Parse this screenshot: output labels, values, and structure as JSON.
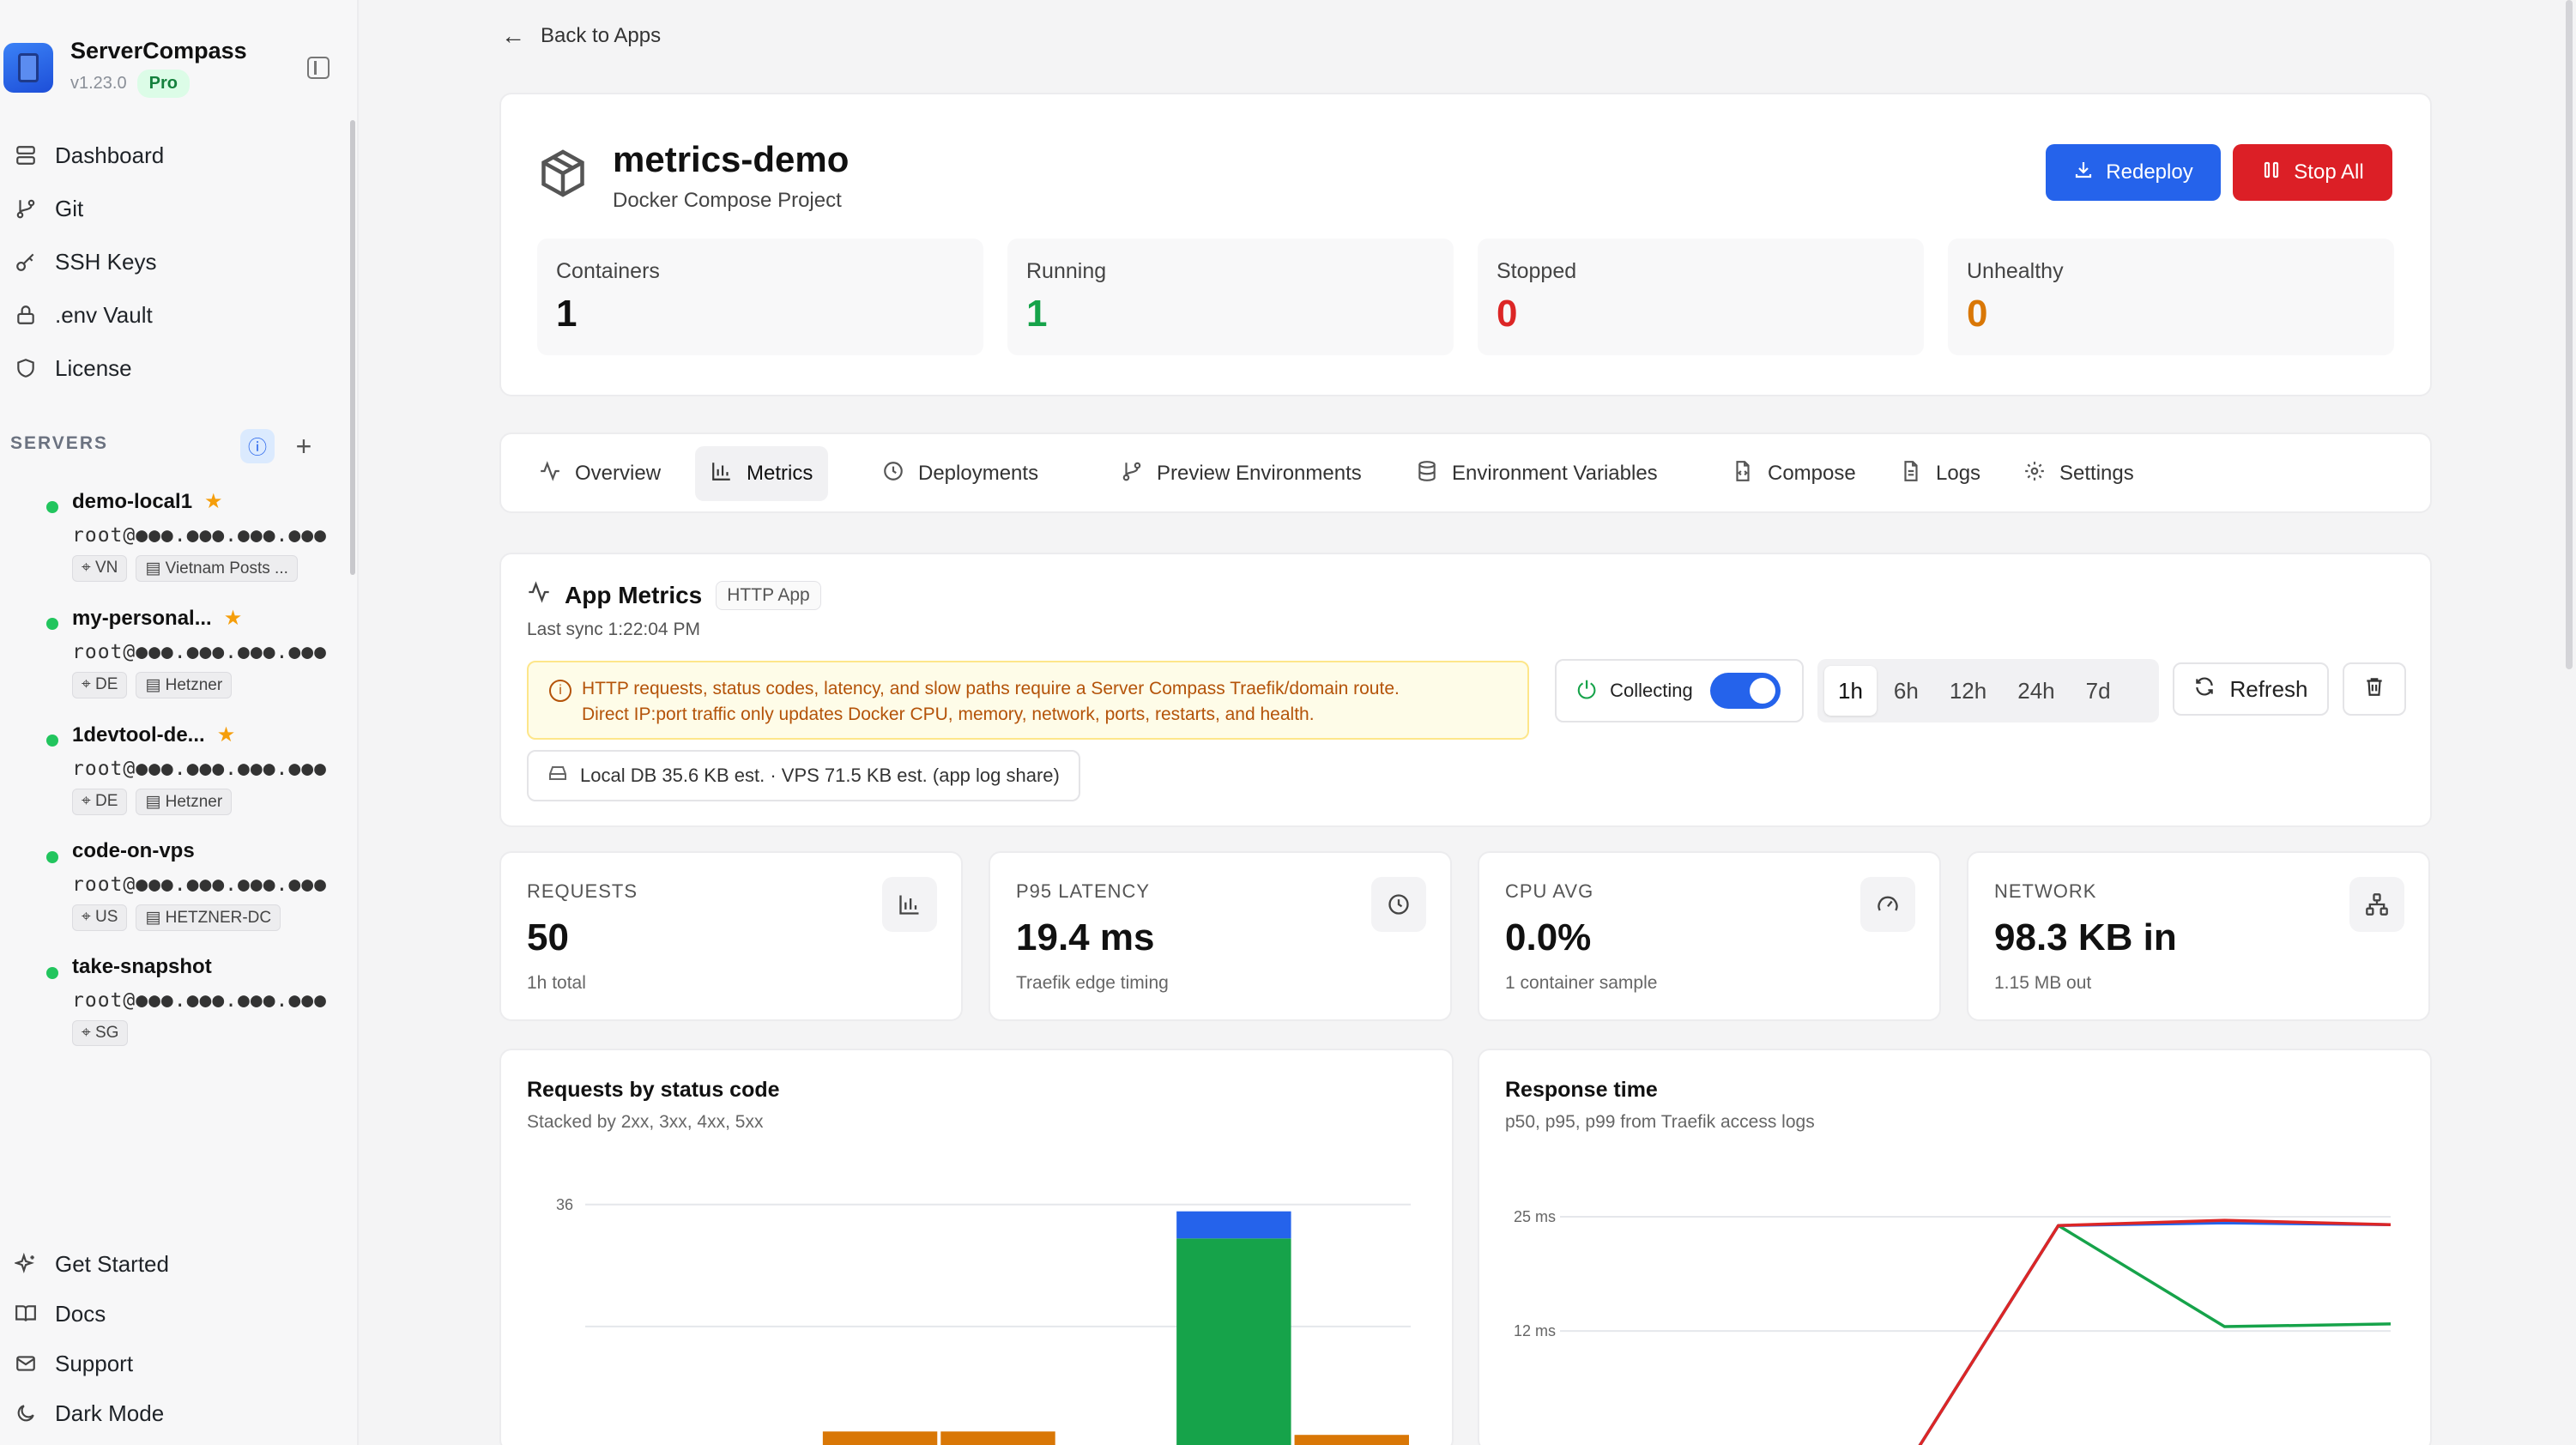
{
  "app": {
    "name": "ServerCompass",
    "version": "v1.23.0",
    "plan": "Pro"
  },
  "nav": [
    {
      "label": "Dashboard",
      "icon": "server-icon"
    },
    {
      "label": "Git",
      "icon": "git-branch-icon"
    },
    {
      "label": "SSH Keys",
      "icon": "key-icon"
    },
    {
      "label": ".env Vault",
      "icon": "lock-icon"
    },
    {
      "label": "License",
      "icon": "shield-icon"
    }
  ],
  "servers_heading": "SERVERS",
  "servers": [
    {
      "name": "demo-local1",
      "starred": true,
      "host": "root@●●●.●●●.●●●.●●●",
      "tags": [
        "VN",
        "Vietnam Posts ..."
      ]
    },
    {
      "name": "my-personal...",
      "starred": true,
      "host": "root@●●●.●●●.●●●.●●●",
      "tags": [
        "DE",
        "Hetzner"
      ]
    },
    {
      "name": "1devtool-de...",
      "starred": true,
      "host": "root@●●●.●●●.●●●.●●●",
      "tags": [
        "DE",
        "Hetzner"
      ]
    },
    {
      "name": "code-on-vps",
      "starred": false,
      "host": "root@●●●.●●●.●●●.●●●",
      "tags": [
        "US",
        "HETZNER-DC"
      ]
    },
    {
      "name": "take-snapshot",
      "starred": false,
      "host": "root@●●●.●●●.●●●.●●●",
      "tags": [
        "SG"
      ]
    }
  ],
  "nav_bottom": [
    {
      "label": "Get Started",
      "icon": "sparkles-icon"
    },
    {
      "label": "Docs",
      "icon": "book-icon"
    },
    {
      "label": "Support",
      "icon": "mail-icon"
    },
    {
      "label": "Dark Mode",
      "icon": "moon-icon"
    }
  ],
  "back_label": "Back to Apps",
  "project": {
    "title": "metrics-demo",
    "subtitle": "Docker Compose Project",
    "redeploy_label": "Redeploy",
    "stop_label": "Stop All",
    "stats": [
      {
        "label": "Containers",
        "value": "1",
        "color": "#111111"
      },
      {
        "label": "Running",
        "value": "1",
        "color": "#16a34a"
      },
      {
        "label": "Stopped",
        "value": "0",
        "color": "#dc2626"
      },
      {
        "label": "Unhealthy",
        "value": "0",
        "color": "#d97706"
      }
    ]
  },
  "tabs": [
    {
      "label": "Overview",
      "icon": "activity-icon",
      "active": false
    },
    {
      "label": "Metrics",
      "icon": "bar-chart-icon",
      "active": true
    },
    {
      "label": "Deployments",
      "icon": "clock-icon",
      "active": false
    },
    {
      "label": "Preview Environments",
      "icon": "git-branch-icon",
      "active": false
    },
    {
      "label": "Environment Variables",
      "icon": "database-icon",
      "active": false
    },
    {
      "label": "Compose",
      "icon": "file-code-icon",
      "active": false
    },
    {
      "label": "Logs",
      "icon": "file-text-icon",
      "active": false
    },
    {
      "label": "Settings",
      "icon": "gear-icon",
      "active": false
    }
  ],
  "metrics": {
    "title": "App Metrics",
    "badge": "HTTP App",
    "last_sync": "Last sync 1:22:04 PM",
    "warning_line1": "HTTP requests, status codes, latency, and slow paths require a Server Compass Traefik/domain route.",
    "warning_line2": "Direct IP:port traffic only updates Docker CPU, memory, network, ports, restarts, and health.",
    "collecting_label": "Collecting",
    "collecting_on": true,
    "ranges": [
      "1h",
      "6h",
      "12h",
      "24h",
      "7d"
    ],
    "active_range": "1h",
    "refresh_label": "Refresh",
    "db_info": "Local DB 35.6 KB est. · VPS 71.5 KB est. (app log share)"
  },
  "kpis": [
    {
      "label": "REQUESTS",
      "value": "50",
      "sub": "1h total",
      "icon": "bar-chart-icon"
    },
    {
      "label": "P95 LATENCY",
      "value": "19.4 ms",
      "sub": "Traefik edge timing",
      "icon": "clock-icon"
    },
    {
      "label": "CPU AVG",
      "value": "0.0%",
      "sub": "1 container sample",
      "icon": "gauge-icon"
    },
    {
      "label": "NETWORK",
      "value": "98.3 KB in",
      "sub": "1.15 MB out",
      "icon": "network-icon"
    }
  ],
  "charts": {
    "status": {
      "title": "Requests by status code",
      "subtitle": "Stacked by 2xx, 3xx, 4xx, 5xx"
    },
    "latency": {
      "title": "Response time",
      "subtitle": "p50, p95, p99 from Traefik access logs"
    }
  },
  "chart_data": [
    {
      "type": "bar",
      "title": "Requests by status code",
      "subtitle": "Stacked by 2xx, 3xx, 4xx, 5xx",
      "ylim": [
        0,
        36
      ],
      "yticks": [
        36
      ],
      "bins": 7,
      "series": [
        {
          "values": [
            0,
            0,
            0,
            0,
            0,
            31,
            0
          ],
          "color": "#16a34a"
        },
        {
          "values": [
            0,
            0,
            0,
            0,
            0,
            4,
            0
          ],
          "color": "#2563eb"
        },
        {
          "values": [
            0.2,
            0.2,
            2.5,
            2.5,
            0,
            0,
            2
          ],
          "color": "#d97706"
        },
        {
          "values": [
            0,
            0,
            0,
            0,
            0.2,
            0,
            0
          ],
          "color": "#14b8a6"
        }
      ]
    },
    {
      "type": "line",
      "title": "Response time",
      "subtitle": "p50, p95, p99 from Traefik access logs",
      "ylim": [
        0,
        25
      ],
      "yticks": [
        {
          "value": 25,
          "label": "25 ms"
        },
        {
          "value": 12,
          "label": "12 ms"
        }
      ],
      "x": [
        0,
        1,
        2,
        3,
        4,
        5
      ],
      "series": [
        {
          "values": [
            null,
            null,
            -6,
            24,
            12.5,
            12.8
          ],
          "color": "#16a34a"
        },
        {
          "values": [
            null,
            null,
            -6,
            24,
            24.3,
            24.1
          ],
          "color": "#2563eb"
        },
        {
          "values": [
            null,
            null,
            -6,
            24,
            24.6,
            24.1
          ],
          "color": "#dc2626"
        }
      ]
    }
  ]
}
